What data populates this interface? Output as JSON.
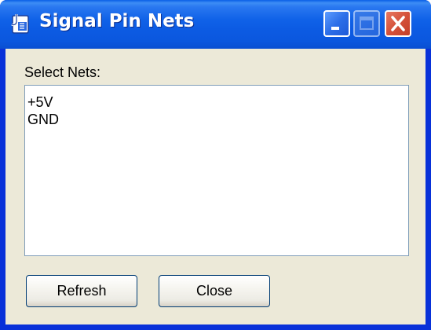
{
  "window": {
    "title": "Signal Pin Nets",
    "icon": "app-icon",
    "controls": [
      "minimize",
      "maximize",
      "close"
    ],
    "accent": "#0a5fe6",
    "close_color": "#d4513a"
  },
  "dialog": {
    "label": "Select Nets:",
    "nets": [
      "+5V",
      "GND"
    ],
    "buttons": {
      "refresh": "Refresh",
      "close": "Close"
    }
  }
}
